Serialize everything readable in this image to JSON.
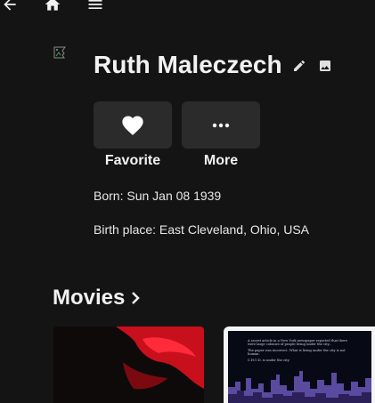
{
  "nav": {
    "back_icon": "arrow-left-icon",
    "home_icon": "home-icon",
    "menu_icon": "hamburger-menu-icon"
  },
  "person": {
    "name": "Ruth Maleczech",
    "born": "Born: Sun Jan 08 1939",
    "birth_place": "Birth place: East Cleveland, Ohio, USA"
  },
  "actions": {
    "favorite_label": "Favorite",
    "more_label": "More"
  },
  "section": {
    "title": "Movies"
  },
  "posters": {
    "second": {
      "lines": [
        "A secret article in a New York newspaper reported that there were large colonies of people living under the city...",
        "The paper was incorrect. What is living under the city is not human.",
        "C.H.U.D. is under the city."
      ]
    }
  },
  "colors": {
    "background": "#141414",
    "button_bg": "#2b2b2b",
    "text": "#f2f2f2",
    "poster_red": "#d01020"
  }
}
